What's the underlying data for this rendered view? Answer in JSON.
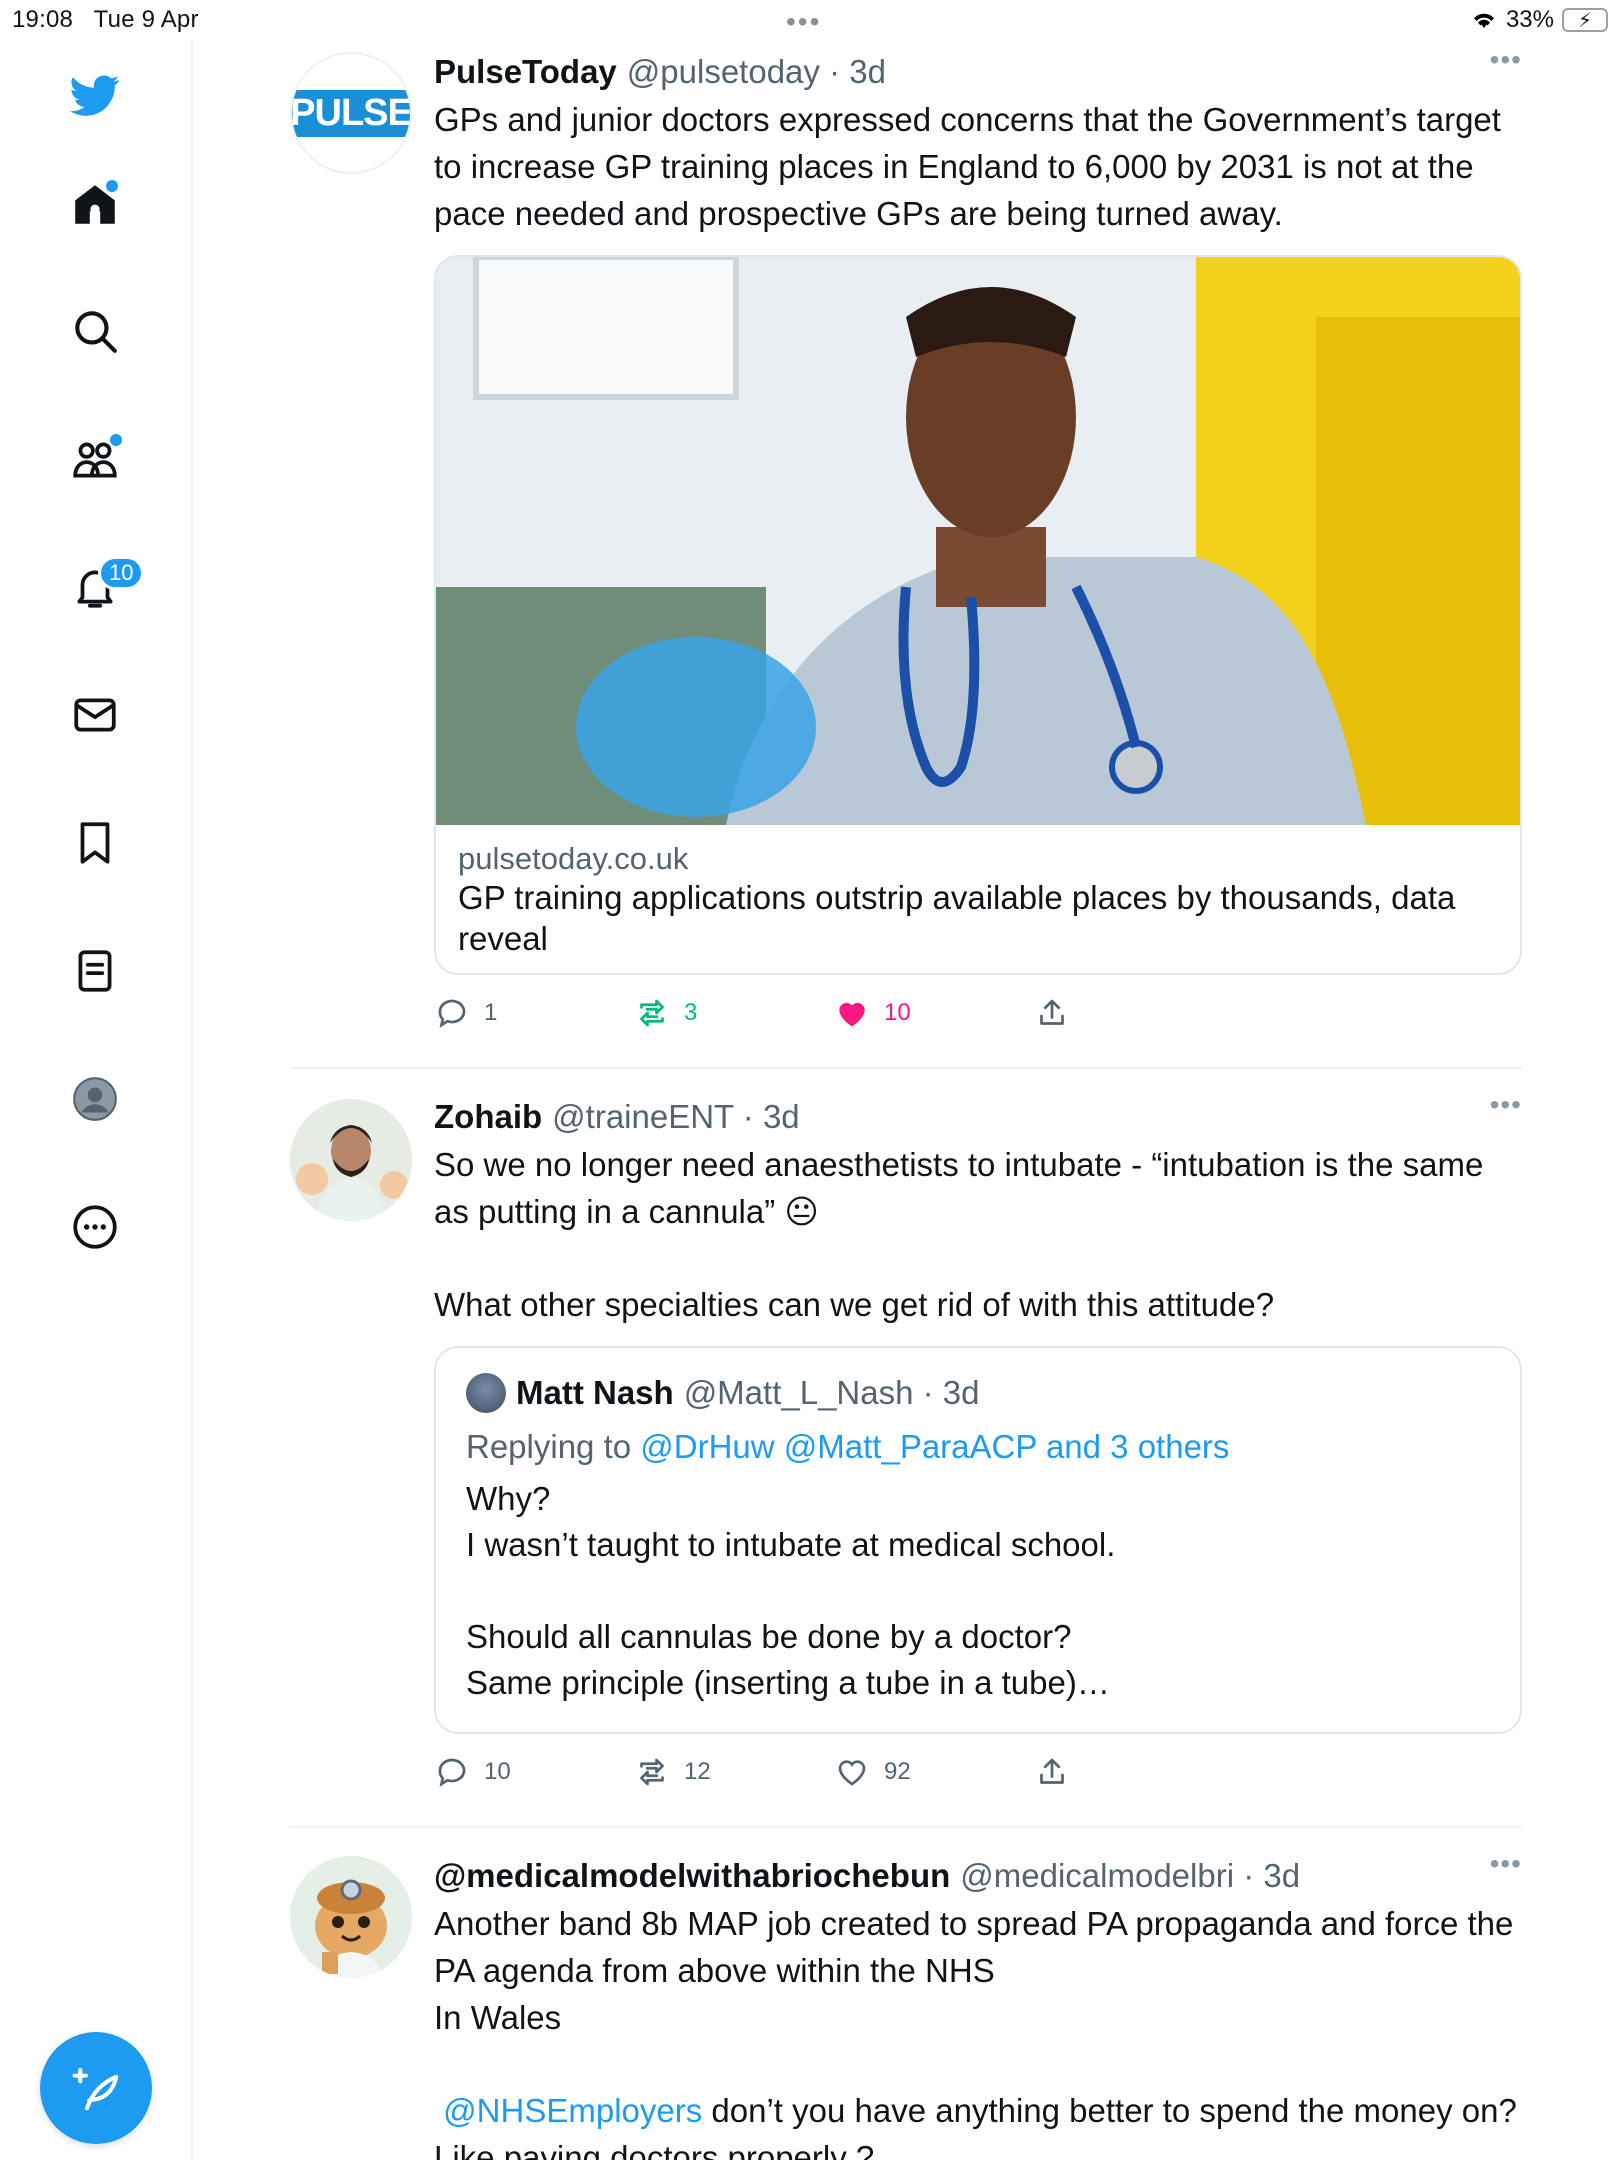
{
  "status": {
    "time": "19:08",
    "date": "Tue 9 Apr",
    "dots": "•••",
    "battery": "33%"
  },
  "sidebar": {
    "items": [
      {
        "name": "home",
        "icon": "home-icon"
      },
      {
        "name": "search",
        "icon": "search-icon"
      },
      {
        "name": "communities",
        "icon": "communities-icon"
      },
      {
        "name": "notifications",
        "icon": "bell-icon",
        "badge": "10"
      },
      {
        "name": "messages",
        "icon": "mail-icon"
      },
      {
        "name": "bookmarks",
        "icon": "bookmark-icon"
      },
      {
        "name": "lists",
        "icon": "list-icon"
      },
      {
        "name": "profile",
        "icon": "profile-icon"
      },
      {
        "name": "more",
        "icon": "more-icon"
      }
    ],
    "accent": "#1d9bf0"
  },
  "tweets": [
    {
      "name": "PulseToday",
      "handle": "@pulsetoday",
      "time": "· 3d",
      "avatar_text": "PULSE",
      "text": "GPs and junior doctors expressed concerns that the Government’s target to increase GP training places in England to 6,000 by 2031 is not at the pace needed and prospective GPs are being turned away.",
      "card": {
        "domain": "pulsetoday.co.uk",
        "title": "GP training applications outstrip available places by thousands, data reveal"
      },
      "replies": "1",
      "retweets": "3",
      "likes": "10"
    },
    {
      "name": "Zohaib",
      "handle": "@traineENT",
      "time": "· 3d",
      "text1": "So we no longer need anaesthetists  to intubate - “intubation is the same as putting in a cannula”  😐",
      "text2": "What other specialties can we get rid of with this attitude?",
      "quote": {
        "name": "Matt Nash",
        "handle": "@Matt_L_Nash",
        "time": "· 3d",
        "replying_label": "Replying to",
        "replying_to": "@DrHuw @Matt_ParaACP and 3 others",
        "line1": "Why?",
        "line2": "I wasn’t taught to intubate at medical school.",
        "line3": "Should all cannulas be done by a doctor?",
        "line4": "Same principle (inserting a tube in a tube)…"
      },
      "replies": "10",
      "retweets": "12",
      "likes": "92"
    },
    {
      "name": "@medicalmodelwithabriochebun",
      "handle": "@medicalmodelbri",
      "time": "· 3d",
      "text1": "Another band 8b MAP job  created to spread PA propaganda and force the PA agenda from above within the NHS",
      "text2": "In Wales",
      "mention": "@NHSEmployers",
      "text3": " don’t you have anything better to spend the money on? Like paying doctors properly ?"
    }
  ],
  "more_label": "•••"
}
